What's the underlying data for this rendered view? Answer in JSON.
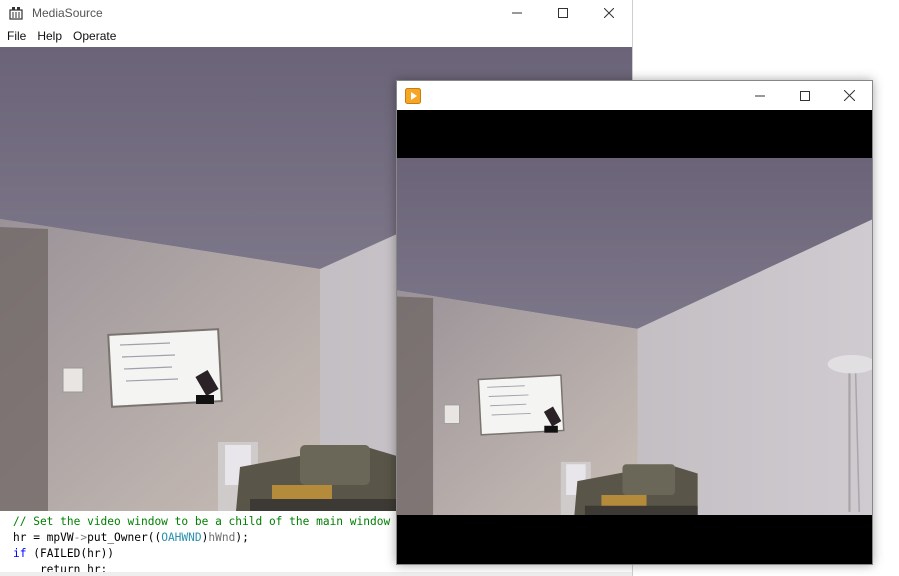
{
  "main_window": {
    "title": "MediaSource",
    "menu": [
      "File",
      "Help",
      "Operate"
    ],
    "controls": {
      "minimize": "minimize-icon",
      "maximize": "maximize-icon",
      "close": "close-icon"
    }
  },
  "code": {
    "line1": "// Set the video window to be a child of the main window",
    "line2_a": "hr = mpVW",
    "line2_arrow": "->",
    "line2_b": "put_Owner((",
    "line2_type": "OAHWND",
    "line2_c": ")",
    "line2_id": "hWnd",
    "line2_d": ");",
    "line3_kw": "if",
    "line3_rest": " (FAILED(hr))",
    "line4": "    return hr;"
  },
  "renderer_window": {
    "icon": "media-player-icon",
    "controls": {
      "minimize": "minimize-icon",
      "maximize": "maximize-icon",
      "close": "close-icon"
    }
  },
  "colors": {
    "comment": "#008000",
    "keyword": "#0000ff",
    "type": "#2b91af",
    "letterbox": "#000000"
  }
}
